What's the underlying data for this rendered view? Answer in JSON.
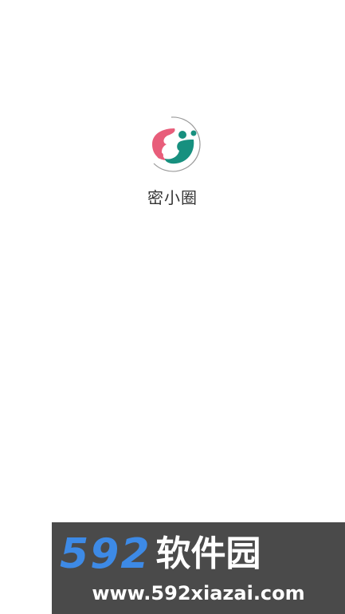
{
  "app": {
    "name": "密小圈",
    "logo_icon": "people-circle-logo-icon"
  },
  "watermark": {
    "brand_digits": "592",
    "brand_text": "软件园",
    "url": "www.592xiazai.com"
  },
  "colors": {
    "background": "#ffffff",
    "logo_pink": "#e85d7a",
    "logo_teal": "#17907f",
    "watermark_bg": "#4a4a4a",
    "watermark_blue": "#3d8ae6"
  }
}
